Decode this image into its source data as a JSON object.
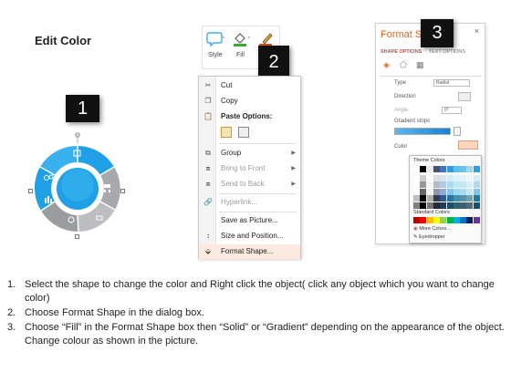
{
  "heading": "Edit Color",
  "badges": {
    "step1": "1",
    "step2": "2",
    "step3": "3"
  },
  "ribbon": {
    "style_label": "Style",
    "fill_label": "Fill",
    "outline_label": "O"
  },
  "context_menu": {
    "items": [
      {
        "icon": "cut-icon",
        "label": "Cut",
        "dim": false
      },
      {
        "icon": "copy-icon",
        "label": "Copy",
        "dim": false
      },
      {
        "icon": "paste-icon",
        "label": "Paste Options:",
        "dim": false
      },
      {
        "icon": "group-icon",
        "label": "Group",
        "dim": false,
        "submenu": true
      },
      {
        "icon": "bring-to-front-icon",
        "label": "Bring to Front",
        "dim": true,
        "submenu": true
      },
      {
        "icon": "send-to-back-icon",
        "label": "Send to Back",
        "dim": true,
        "submenu": true
      },
      {
        "icon": "hyperlink-icon",
        "label": "Hyperlink...",
        "dim": true
      },
      {
        "icon": "",
        "label": "Save as Picture...",
        "dim": false
      },
      {
        "icon": "size-position-icon",
        "label": "Size and Position...",
        "dim": false
      },
      {
        "icon": "format-shape-icon",
        "label": "Format Shape...",
        "dim": false,
        "highlighted": true
      }
    ]
  },
  "format_pane": {
    "title": "Format S",
    "tab_shape_options": "SHAPE OPTIONS",
    "tab_text_options": "TEXT OPTIONS",
    "close_glyph": "×",
    "type_label": "Type",
    "type_value": "Radial",
    "direction_label": "Direction",
    "angle_label": "Angle",
    "angle_value": "0°",
    "gradient_stops_label": "Gradient stops",
    "color_label": "Color"
  },
  "palette": {
    "theme_colors_label": "Theme Colors",
    "standard_colors_label": "Standard Colors",
    "more_colors_label": "More Colors...",
    "eyedropper_label": "Eyedropper",
    "theme_top_row": [
      "#ffffff",
      "#000000",
      "#e8e8e8",
      "#44546a",
      "#4472c4",
      "#2e9ed6",
      "#5bc0eb",
      "#70c1e6",
      "#9fd7f0",
      "#25a3e0"
    ],
    "standard_row": [
      "#c00000",
      "#ff0000",
      "#ffc000",
      "#ffff00",
      "#92d050",
      "#00b050",
      "#00b0f0",
      "#0070c0",
      "#002060",
      "#7030a0"
    ]
  },
  "instructions": [
    {
      "num": "1.",
      "text": "Select the shape to change the color and Right click the object( click any object which you want to change color)"
    },
    {
      "num": "2.",
      "text": "Choose Format Shape in the dialog box."
    },
    {
      "num": "3.",
      "text": "Choose “Fill” in the Format Shape box then “Solid” or “Gradient” depending on the appearance of the object. Change colour as shown in the picture."
    }
  ],
  "colors": {
    "accent_blue": "#1e9fe6",
    "ring_gray": "#a7a9ac",
    "highlight": "#fce9df",
    "pane_title": "#d2691e"
  }
}
